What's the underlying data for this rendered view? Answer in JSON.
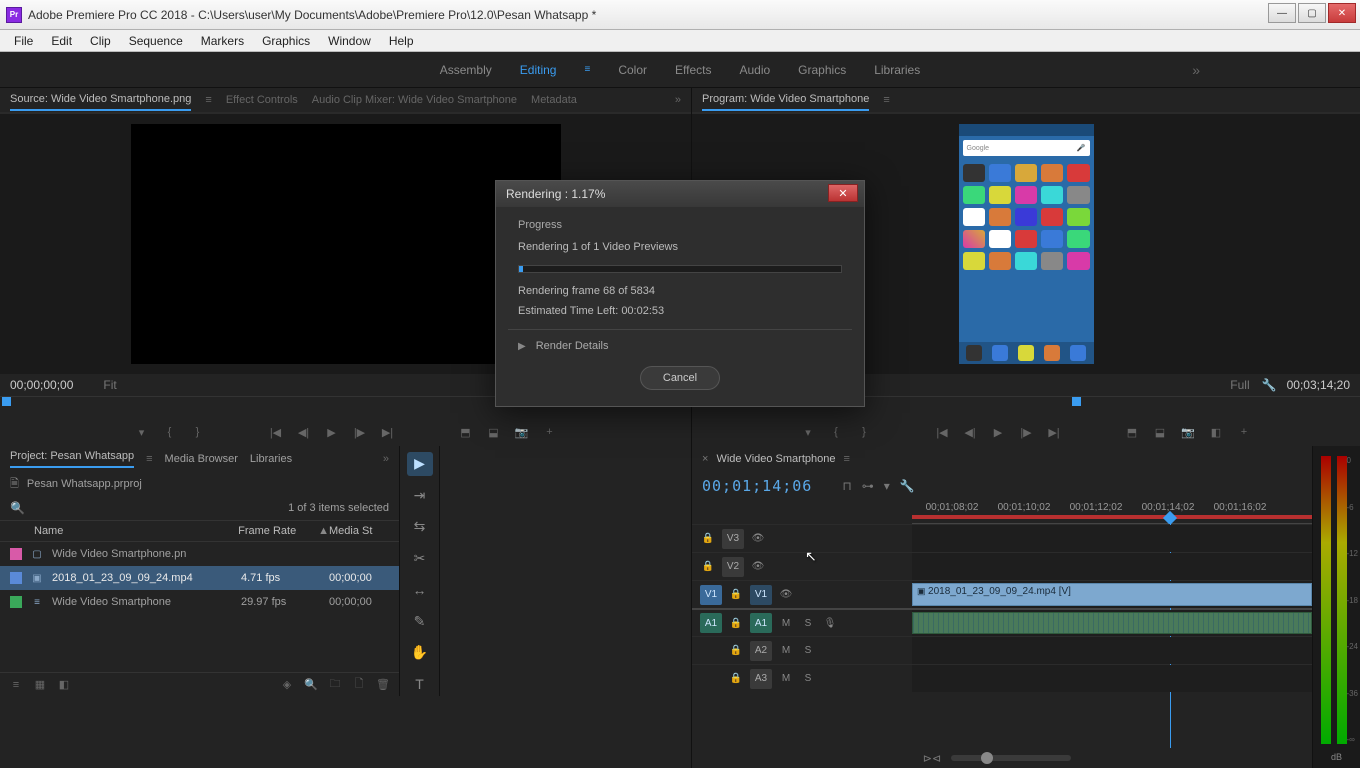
{
  "window": {
    "title": "Adobe Premiere Pro CC 2018 - C:\\Users\\user\\My Documents\\Adobe\\Premiere Pro\\12.0\\Pesan Whatsapp *",
    "icon_label": "Pr",
    "minimize": "—",
    "maximize": "▢",
    "close": "✕"
  },
  "menubar": [
    "File",
    "Edit",
    "Clip",
    "Sequence",
    "Markers",
    "Graphics",
    "Window",
    "Help"
  ],
  "workspaces": [
    "Assembly",
    "Editing",
    "Color",
    "Effects",
    "Audio",
    "Graphics",
    "Libraries"
  ],
  "workspace_active": "Editing",
  "source_panel": {
    "tabs": [
      "Source: Wide Video Smartphone.png",
      "Effect Controls",
      "Audio Clip Mixer: Wide Video Smartphone",
      "Metadata"
    ],
    "timecode_left": "00;00;00;00",
    "fit_label": "Fit"
  },
  "program_panel": {
    "tab": "Program: Wide Video Smartphone",
    "timecode_right": "00;03;14;20",
    "fit_label": "Full",
    "phone_search": "Google"
  },
  "project_panel": {
    "tabs": [
      "Project: Pesan Whatsapp",
      "Media Browser",
      "Libraries"
    ],
    "file": "Pesan Whatsapp.prproj",
    "status": "1 of 3 items selected",
    "columns": {
      "name": "Name",
      "framerate": "Frame Rate",
      "mediastart": "Media St"
    },
    "items": [
      {
        "chip": "#d85aa8",
        "name": "Wide Video Smartphone.pn",
        "framerate": "",
        "ms": ""
      },
      {
        "chip": "#5a8ad8",
        "name": "2018_01_23_09_09_24.mp4",
        "framerate": "4.71 fps",
        "ms": "00;00;00"
      },
      {
        "chip": "#3aa85a",
        "name": "Wide Video Smartphone",
        "framerate": "29.97 fps",
        "ms": "00;00;00"
      }
    ],
    "selected_index": 1
  },
  "timeline": {
    "tab": "Wide Video Smartphone",
    "big_time": "00;01;14;06",
    "ruler_labels": [
      "00;01;08;02",
      "00;01;10;02",
      "00;01;12;02",
      "00;01;14;02",
      "00;01;16;02"
    ],
    "video_tracks": [
      "V3",
      "V2",
      "V1"
    ],
    "audio_tracks": [
      "A1",
      "A2",
      "A3"
    ],
    "clip_v1": "2018_01_23_09_09_24.mp4 [V]"
  },
  "meters": {
    "labels": [
      "0",
      "-6",
      "-12",
      "-18",
      "-24",
      "-36",
      "-∞"
    ],
    "db": "dB"
  },
  "render_dialog": {
    "title": "Rendering : 1.17%",
    "section": "Progress",
    "line1": "Rendering 1 of 1 Video Previews",
    "line2": "Rendering frame 68 of 5834",
    "line3": "Estimated Time Left: 00:02:53",
    "details": "Render Details",
    "cancel": "Cancel"
  }
}
